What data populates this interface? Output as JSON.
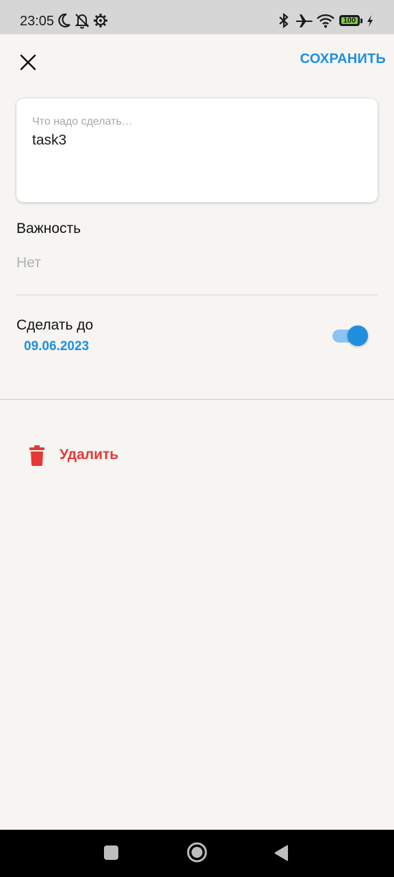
{
  "status_bar": {
    "time": "23:05",
    "battery_level": "100",
    "battery_fraction": 1.0,
    "icons": [
      "moon-icon",
      "bell-off-icon",
      "gear-icon",
      "bluetooth-icon",
      "airplane-icon",
      "wifi-icon",
      "battery-icon",
      "charging-icon"
    ]
  },
  "header": {
    "close_icon": "close-icon",
    "save_label": "СОХРАНИТЬ"
  },
  "task": {
    "placeholder": "Что надо сделать…",
    "value": "task3"
  },
  "importance": {
    "label": "Важность",
    "value": "Нет"
  },
  "deadline": {
    "label": "Сделать до",
    "date": "09.06.2023",
    "enabled": true
  },
  "delete": {
    "label": "Удалить",
    "icon": "trash-icon"
  },
  "nav": {
    "icons": [
      "recents-icon",
      "home-icon",
      "back-icon"
    ]
  },
  "colors": {
    "accent": "#1f8fe0",
    "danger": "#e53935",
    "background": "#f6f5f2",
    "secondary_text": "#b0b0b0"
  }
}
